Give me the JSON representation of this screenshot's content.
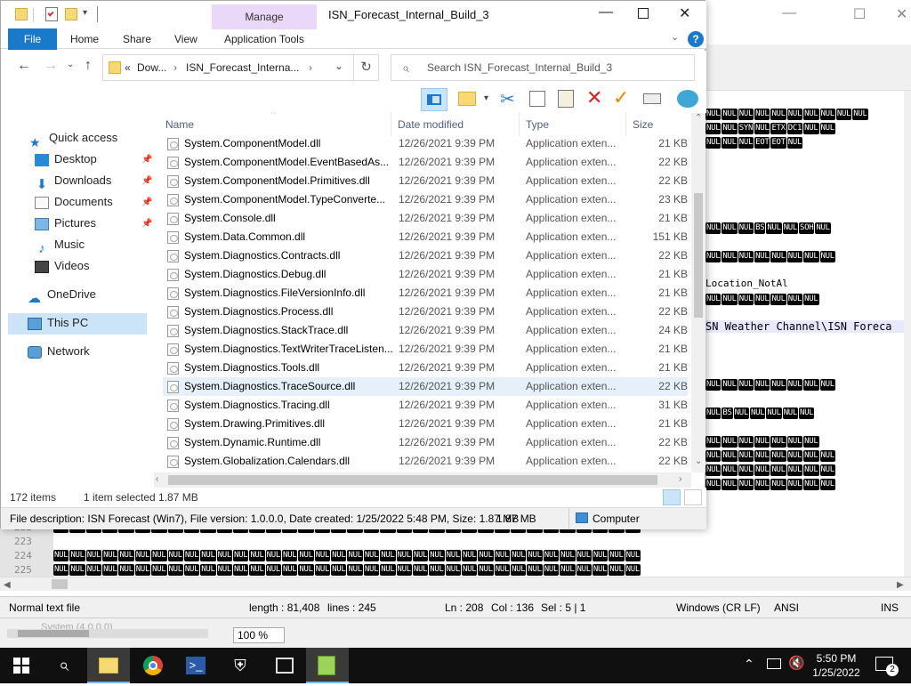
{
  "explorer": {
    "title": "ISN_Forecast_Internal_Build_3",
    "manage_tab": "Manage",
    "app_tools_tab": "Application Tools",
    "tabs": [
      "File",
      "Home",
      "Share",
      "View"
    ],
    "breadcrumb": [
      "«",
      "Dow...",
      "›",
      "ISN_Forecast_Interna...",
      "›"
    ],
    "search_placeholder": "Search ISN_Forecast_Internal_Build_3",
    "nav": {
      "quick_access": "Quick access",
      "desktop": "Desktop",
      "downloads": "Downloads",
      "documents": "Documents",
      "pictures": "Pictures",
      "music": "Music",
      "videos": "Videos",
      "onedrive": "OneDrive",
      "this_pc": "This PC",
      "network": "Network"
    },
    "columns": {
      "name": "Name",
      "date": "Date modified",
      "type": "Type",
      "size": "Size"
    },
    "files": [
      {
        "name": "System.ComponentModel.dll",
        "date": "12/26/2021 9:39 PM",
        "type": "Application exten...",
        "size": "21 KB"
      },
      {
        "name": "System.ComponentModel.EventBasedAs...",
        "date": "12/26/2021 9:39 PM",
        "type": "Application exten...",
        "size": "22 KB"
      },
      {
        "name": "System.ComponentModel.Primitives.dll",
        "date": "12/26/2021 9:39 PM",
        "type": "Application exten...",
        "size": "22 KB"
      },
      {
        "name": "System.ComponentModel.TypeConverte...",
        "date": "12/26/2021 9:39 PM",
        "type": "Application exten...",
        "size": "23 KB"
      },
      {
        "name": "System.Console.dll",
        "date": "12/26/2021 9:39 PM",
        "type": "Application exten...",
        "size": "21 KB"
      },
      {
        "name": "System.Data.Common.dll",
        "date": "12/26/2021 9:39 PM",
        "type": "Application exten...",
        "size": "151 KB"
      },
      {
        "name": "System.Diagnostics.Contracts.dll",
        "date": "12/26/2021 9:39 PM",
        "type": "Application exten...",
        "size": "22 KB"
      },
      {
        "name": "System.Diagnostics.Debug.dll",
        "date": "12/26/2021 9:39 PM",
        "type": "Application exten...",
        "size": "21 KB"
      },
      {
        "name": "System.Diagnostics.FileVersionInfo.dll",
        "date": "12/26/2021 9:39 PM",
        "type": "Application exten...",
        "size": "21 KB"
      },
      {
        "name": "System.Diagnostics.Process.dll",
        "date": "12/26/2021 9:39 PM",
        "type": "Application exten...",
        "size": "22 KB"
      },
      {
        "name": "System.Diagnostics.StackTrace.dll",
        "date": "12/26/2021 9:39 PM",
        "type": "Application exten...",
        "size": "24 KB"
      },
      {
        "name": "System.Diagnostics.TextWriterTraceListen...",
        "date": "12/26/2021 9:39 PM",
        "type": "Application exten...",
        "size": "21 KB"
      },
      {
        "name": "System.Diagnostics.Tools.dll",
        "date": "12/26/2021 9:39 PM",
        "type": "Application exten...",
        "size": "21 KB"
      },
      {
        "name": "System.Diagnostics.TraceSource.dll",
        "date": "12/26/2021 9:39 PM",
        "type": "Application exten...",
        "size": "22 KB"
      },
      {
        "name": "System.Diagnostics.Tracing.dll",
        "date": "12/26/2021 9:39 PM",
        "type": "Application exten...",
        "size": "31 KB"
      },
      {
        "name": "System.Drawing.Primitives.dll",
        "date": "12/26/2021 9:39 PM",
        "type": "Application exten...",
        "size": "21 KB"
      },
      {
        "name": "System.Dynamic.Runtime.dll",
        "date": "12/26/2021 9:39 PM",
        "type": "Application exten...",
        "size": "22 KB"
      },
      {
        "name": "System.Globalization.Calendars.dll",
        "date": "12/26/2021 9:39 PM",
        "type": "Application exten...",
        "size": "22 KB"
      }
    ],
    "status_items": "172 items",
    "status_selected": "1 item selected  1.87 MB",
    "details": "File description: ISN Forecast (Win7), File version: 1.0.0.0, Date created: 1/25/2022 5:48 PM, Size: 1.87 MB",
    "details_size": "1.87 MB",
    "details_location": "Computer"
  },
  "notepad": {
    "line_numbers": [
      "222",
      "223",
      "224",
      "225"
    ],
    "text_location": "Location_NotAl",
    "text_path": "SN Weather Channel\\ISN Foreca",
    "text_misc": "NUL:NULEOTEOTÉ?èÆ³Y(",
    "status_type": "Normal text file",
    "status_length": "length : 81,408",
    "status_lines": "lines : 245",
    "status_ln": "Ln : 208",
    "status_col": "Col : 136",
    "status_sel": "Sel : 5 | 1",
    "status_eol": "Windows (CR LF)",
    "status_enc": "ANSI",
    "status_ins": "INS",
    "bottom_panel_text": "System (4.0.0.0)",
    "zoom": "100 %"
  },
  "taskbar": {
    "time": "5:50 PM",
    "date": "1/25/2022",
    "notifications": "2"
  }
}
